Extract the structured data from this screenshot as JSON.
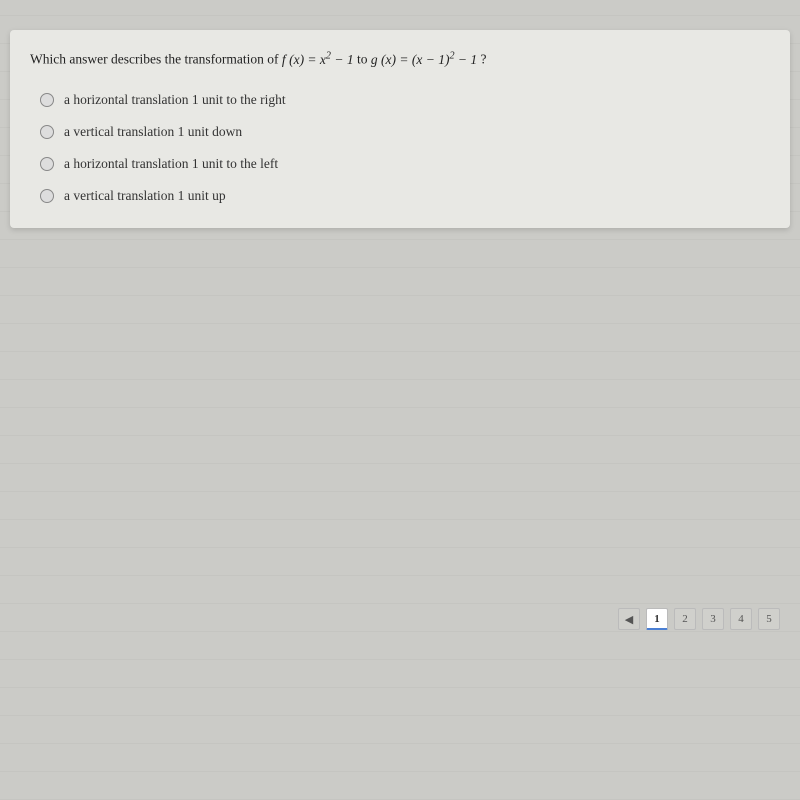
{
  "question": {
    "prefix": "Which answer describes the transformation of",
    "f_label": "f(x) = x² − 1",
    "to_text": "to",
    "g_label": "g(x) = (x − 1)² − 1",
    "suffix": "?"
  },
  "options": [
    {
      "id": "opt1",
      "text": "a horizontal translation 1 unit to the right"
    },
    {
      "id": "opt2",
      "text": "a vertical translation 1 unit down"
    },
    {
      "id": "opt3",
      "text": "a horizontal translation 1 unit to the left"
    },
    {
      "id": "opt4",
      "text": "a vertical translation 1 unit up"
    }
  ],
  "pagination": {
    "prev_label": "◀",
    "pages": [
      "1",
      "2",
      "3",
      "4",
      "5"
    ],
    "active_page": "1"
  }
}
